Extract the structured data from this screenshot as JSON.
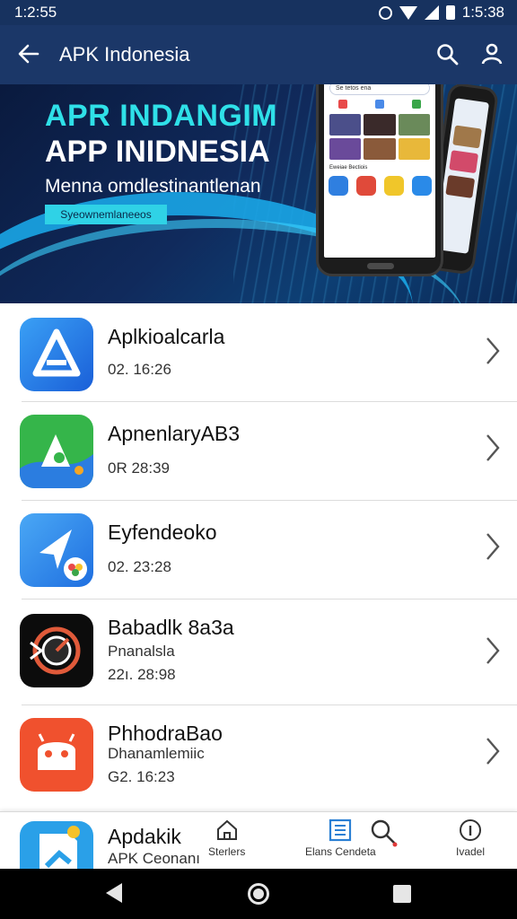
{
  "status_bar": {
    "time_left": "1:2:55",
    "time_right": "1:5:38"
  },
  "app_bar": {
    "title": "APK Indonesia"
  },
  "banner": {
    "headline1": "APR INDANGIM",
    "headline2": "APP INIDNESIA",
    "subtitle": "Menna omdlestinantlenan",
    "button_label": "Syeownemlaneeos",
    "phone": {
      "search_text": "Se tetos ena",
      "section_caption": "Eweiae Bectiois"
    }
  },
  "apps": [
    {
      "name": "Aplkioalcarla",
      "sub": "",
      "meta": "02. 16:26"
    },
    {
      "name": "ApnenlaryAB3",
      "sub": "",
      "meta": "0R 28:39"
    },
    {
      "name": "Eyfendeoko",
      "sub": "",
      "meta": "02. 23:28"
    },
    {
      "name": "Babadlk 8a3a",
      "sub": "Pnanalsla",
      "meta": "22ı. 28:98"
    },
    {
      "name": "PhhodraBao",
      "sub": "Dhanamlemiic",
      "meta": "G2. 16:23"
    },
    {
      "name": "Apdakik",
      "sub": "APK Ceonanı",
      "meta": ""
    }
  ],
  "bottom_nav": [
    {
      "label": "Sterlers",
      "icon": "home-icon"
    },
    {
      "label": "Elans Cendeta",
      "icon": "list-icon"
    },
    {
      "label": "",
      "icon": "search-icon"
    },
    {
      "label": "Ivadel",
      "icon": "info-icon"
    }
  ],
  "colors": {
    "status_bar": "#17325f",
    "app_bar": "#1b3768",
    "accent_cyan": "#2fe0e8",
    "active_tab": "#2a7fd4"
  }
}
